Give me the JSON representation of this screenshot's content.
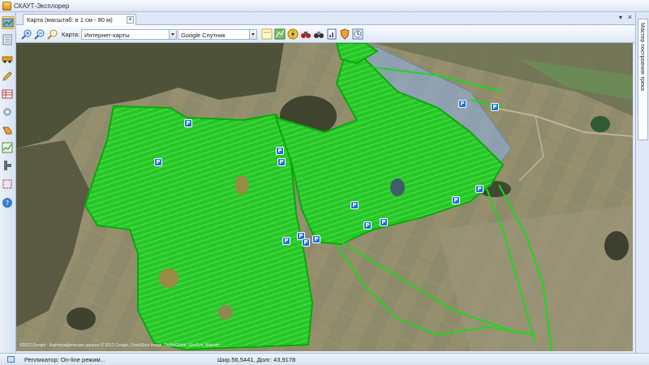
{
  "app": {
    "title": "СКАУТ-Эксплорер"
  },
  "tab": {
    "label": "Карта (масштаб: в 1 см - 80 м)",
    "close_label": "×",
    "menu_label": "▾",
    "window_close_label": "×"
  },
  "toolbar": {
    "map_label": "Карта:",
    "map_source": "Интернет-карты",
    "map_layer": "Google Спутник",
    "buttons": [
      "zoom-in-icon",
      "zoom-out-icon",
      "zoom-area-icon",
      "layers-icon",
      "track-icon",
      "lightning-icon",
      "binoculars-icon",
      "binoculars-find-icon",
      "report-icon",
      "shield-icon",
      "clock-icon"
    ]
  },
  "left_toolbar": {
    "buttons": [
      "map-icon",
      "objects-icon",
      "vehicle-icon",
      "edit-icon",
      "table-icon",
      "settings-icon",
      "fuel-icon",
      "chart-icon",
      "sensor-icon",
      "fullscreen-icon",
      "help-icon"
    ]
  },
  "side_panel": {
    "tab_label": "Мастер построения трека"
  },
  "map": {
    "parking_marker": "P",
    "attribution": "©2012 Google · Картографические данные © 2012 Google, Cnes/Spot Image, DigitalGlobe, GeoEye, Mapabc",
    "colors": {
      "track_fill": "#22cc22",
      "track_stroke": "#0aa80a",
      "parking": "#1f6fd6",
      "selection": "#8fb2e8"
    }
  },
  "statusbar": {
    "replicator": "Репликатор: On-line режим...",
    "coordinates": "Шир.56,5441, Долг: 43,9178"
  }
}
